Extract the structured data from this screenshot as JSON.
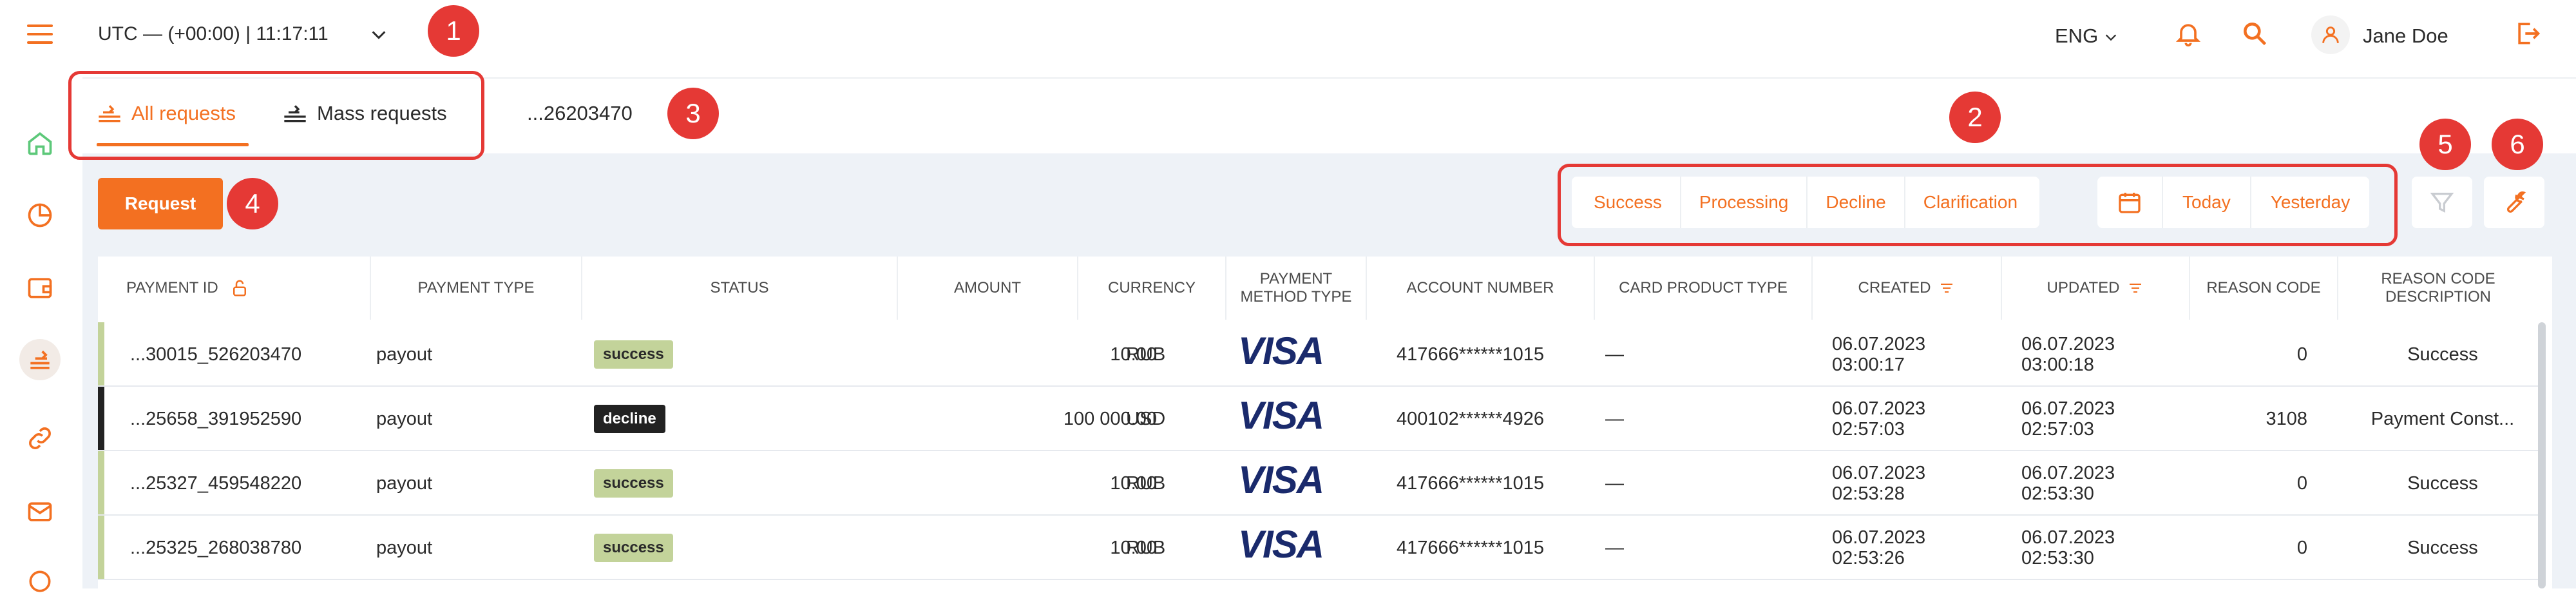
{
  "header": {
    "timezone": "UTC — (+00:00) | ",
    "time": "11:17:11",
    "language": "ENG",
    "user_name": "Jane Doe"
  },
  "tabs": {
    "all_requests": "All requests",
    "mass_requests": "Mass requests",
    "search_tab": "...26203470"
  },
  "toolbar": {
    "request_label": "Request",
    "status_filters": [
      "Success",
      "Processing",
      "Decline",
      "Clarification"
    ],
    "date_filters": [
      "Today",
      "Yesterday"
    ]
  },
  "table": {
    "columns": {
      "payment_id": "PAYMENT ID",
      "payment_type": "PAYMENT TYPE",
      "status": "STATUS",
      "amount": "AMOUNT",
      "currency": "CURRENCY",
      "payment_method_type": "PAYMENT METHOD TYPE",
      "account_number": "ACCOUNT NUMBER",
      "card_product_type": "CARD PRODUCT TYPE",
      "created": "CREATED",
      "updated": "UPDATED",
      "reason_code": "REASON CODE",
      "reason_code_description": "REASON CODE DESCRIPTION"
    },
    "rows": [
      {
        "payment_id": "...30015_526203470",
        "payment_type": "payout",
        "status": "success",
        "amount": "10.00",
        "currency": "RUB",
        "method": "VISA",
        "account": "417666******1015",
        "card_type": "—",
        "created_date": "06.07.2023",
        "created_time": "03:00:17",
        "updated_date": "06.07.2023",
        "updated_time": "03:00:18",
        "reason_code": "0",
        "reason_desc": "Success"
      },
      {
        "payment_id": "...25658_391952590",
        "payment_type": "payout",
        "status": "decline",
        "amount": "100 000.00",
        "currency": "USD",
        "method": "VISA",
        "account": "400102******4926",
        "card_type": "—",
        "created_date": "06.07.2023",
        "created_time": "02:57:03",
        "updated_date": "06.07.2023",
        "updated_time": "02:57:03",
        "reason_code": "3108",
        "reason_desc": "Payment Const..."
      },
      {
        "payment_id": "...25327_459548220",
        "payment_type": "payout",
        "status": "success",
        "amount": "10.00",
        "currency": "RUB",
        "method": "VISA",
        "account": "417666******1015",
        "card_type": "—",
        "created_date": "06.07.2023",
        "created_time": "02:53:28",
        "updated_date": "06.07.2023",
        "updated_time": "02:53:30",
        "reason_code": "0",
        "reason_desc": "Success"
      },
      {
        "payment_id": "...25325_268038780",
        "payment_type": "payout",
        "status": "success",
        "amount": "10.00",
        "currency": "RUB",
        "method": "VISA",
        "account": "417666******1015",
        "card_type": "—",
        "created_date": "06.07.2023",
        "created_time": "02:53:26",
        "updated_date": "06.07.2023",
        "updated_time": "02:53:30",
        "reason_code": "0",
        "reason_desc": "Success"
      }
    ]
  },
  "annotations": [
    "1",
    "2",
    "3",
    "4",
    "5",
    "6"
  ],
  "colors": {
    "accent": "#f37021",
    "callout": "#e53935",
    "success_badge": "#c3d39a",
    "decline_badge": "#222222",
    "success_bar": "#c3d39a",
    "decline_bar": "#222222"
  }
}
